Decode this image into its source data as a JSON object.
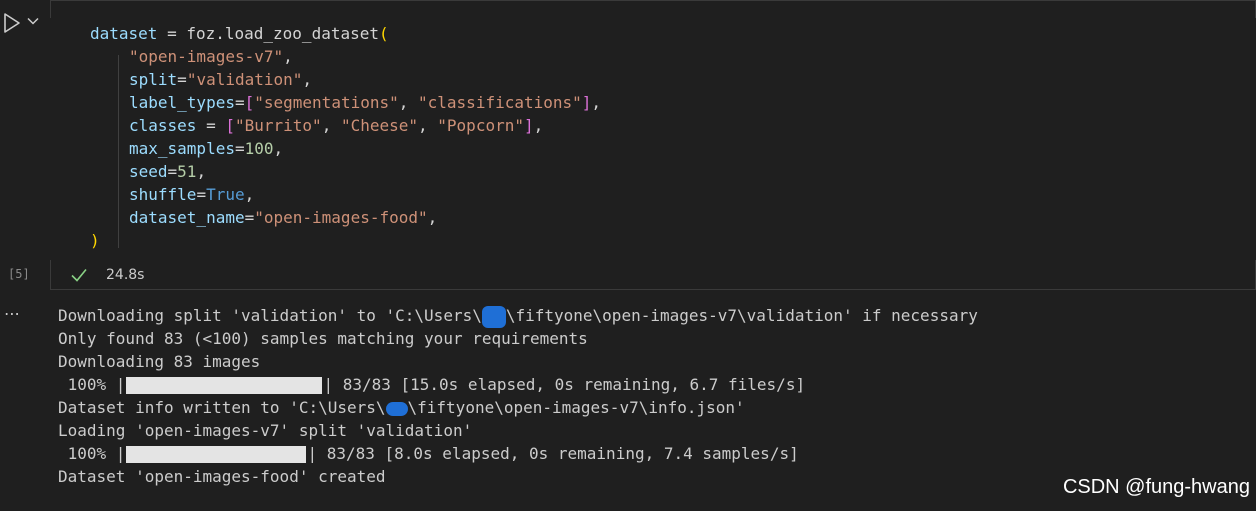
{
  "cell": {
    "execution_count": "[5]",
    "status_duration": "24.8s",
    "icons": [
      "run-icon",
      "chevron-down-icon",
      "check-icon",
      "more-icon"
    ],
    "colors": {
      "background": "#1f1f1f",
      "variable": "#9cdcfe",
      "string": "#ce9178",
      "number": "#b5cea8",
      "keyword": "#569cd6",
      "bracket_outer": "#ffd700",
      "bracket_inner": "#da70d6",
      "success": "#89d185"
    },
    "code": {
      "l1_var": "dataset",
      "l1_eq": " = foz.load_zoo_dataset",
      "l1_paren": "(",
      "l2_str": "\"open-images-v7\"",
      "l2_comma": ",",
      "l3_key": "split",
      "l3_eq": "=",
      "l3_str": "\"validation\"",
      "l3_comma": ",",
      "l4_key": "label_types",
      "l4_eq": "=",
      "l4_open": "[",
      "l4_str1": "\"segmentations\"",
      "l4_sep": ", ",
      "l4_str2": "\"classifications\"",
      "l4_close": "]",
      "l4_comma": ",",
      "l5_key": "classes",
      "l5_eq": " = ",
      "l5_open": "[",
      "l5_str1": "\"Burrito\"",
      "l5_sep1": ", ",
      "l5_str2": "\"Cheese\"",
      "l5_sep2": ", ",
      "l5_str3": "\"Popcorn\"",
      "l5_close": "]",
      "l5_comma": ",",
      "l6_key": "max_samples",
      "l6_eq": "=",
      "l6_num": "100",
      "l6_comma": ",",
      "l7_key": "seed",
      "l7_eq": "=",
      "l7_num": "51",
      "l7_comma": ",",
      "l8_key": "shuffle",
      "l8_eq": "=",
      "l8_kw": "True",
      "l8_comma": ",",
      "l9_key": "dataset_name",
      "l9_eq": "=",
      "l9_str": "\"open-images-food\"",
      "l9_comma": ",",
      "l10_paren": ")"
    }
  },
  "output": {
    "line1_a": "Downloading split 'validation' to 'C:\\Users\\",
    "line1_b": "\\fiftyone\\open-images-v7\\validation' if necessary",
    "line2": "Only found 83 (<100) samples matching your requirements",
    "line3": "Downloading 83 images",
    "progress1": {
      "percent": " 100% |",
      "after": "| 83/83 [15.0s elapsed, 0s remaining, 6.7 files/s]",
      "fraction": 1.0
    },
    "line5_a": "Dataset info written to 'C:\\Users\\",
    "line5_b": "\\fiftyone\\open-images-v7\\info.json'",
    "line6": "Loading 'open-images-v7' split 'validation'",
    "progress2": {
      "percent": " 100% |",
      "after": "| 83/83 [8.0s elapsed, 0s remaining, 7.4 samples/s]",
      "fraction": 1.0
    },
    "line8": "Dataset 'open-images-food' created"
  },
  "watermark": "CSDN @fung-hwang"
}
